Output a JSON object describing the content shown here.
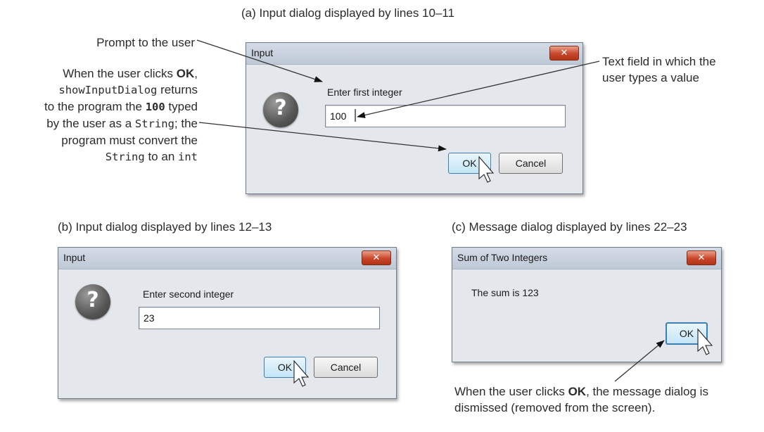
{
  "captions": {
    "a": "(a) Input dialog displayed by lines 10–11",
    "b": "(b) Input dialog displayed by lines 12–13",
    "c": "(c) Message dialog displayed by lines 22–23"
  },
  "annotations": {
    "prompt_note": "Prompt to the user",
    "textfield_note_1": "Text field in which the",
    "textfield_note_2": "user types a value",
    "ok_note": {
      "l1a": "When the user clicks ",
      "l1b": "OK",
      "l1c": ",",
      "l2a": "showInputDialog",
      "l2b": " returns",
      "l3a": "to the program the ",
      "l3b": "100",
      "l3c": " typed",
      "l4a": "by the user as a ",
      "l4b": "String",
      "l4c": "; the",
      "l5": "program must convert the",
      "l6a": "String",
      "l6b": " to an ",
      "l6c": "int"
    },
    "dismiss_note": {
      "l1a": "When the user clicks ",
      "l1b": "OK",
      "l1c": ", the message dialog is",
      "l2": "dismissed (removed from the screen)."
    }
  },
  "dialog_a": {
    "title": "Input",
    "close_label": "✕",
    "prompt": "Enter first integer",
    "field_value": "100",
    "ok_label": "OK",
    "cancel_label": "Cancel"
  },
  "dialog_b": {
    "title": "Input",
    "close_label": "✕",
    "prompt": "Enter second integer",
    "field_value": "23",
    "ok_label": "OK",
    "cancel_label": "Cancel"
  },
  "dialog_c": {
    "title": "Sum of Two Integers",
    "close_label": "✕",
    "message": "The sum is 123",
    "ok_label": "OK"
  },
  "icons": {
    "question": "question-icon",
    "close": "close-icon",
    "cursor": "mouse-cursor-icon"
  },
  "colors": {
    "close_button": "#c8462a",
    "dialog_bg": "#e4e7eb",
    "focused_button": "#c4e5f6"
  }
}
